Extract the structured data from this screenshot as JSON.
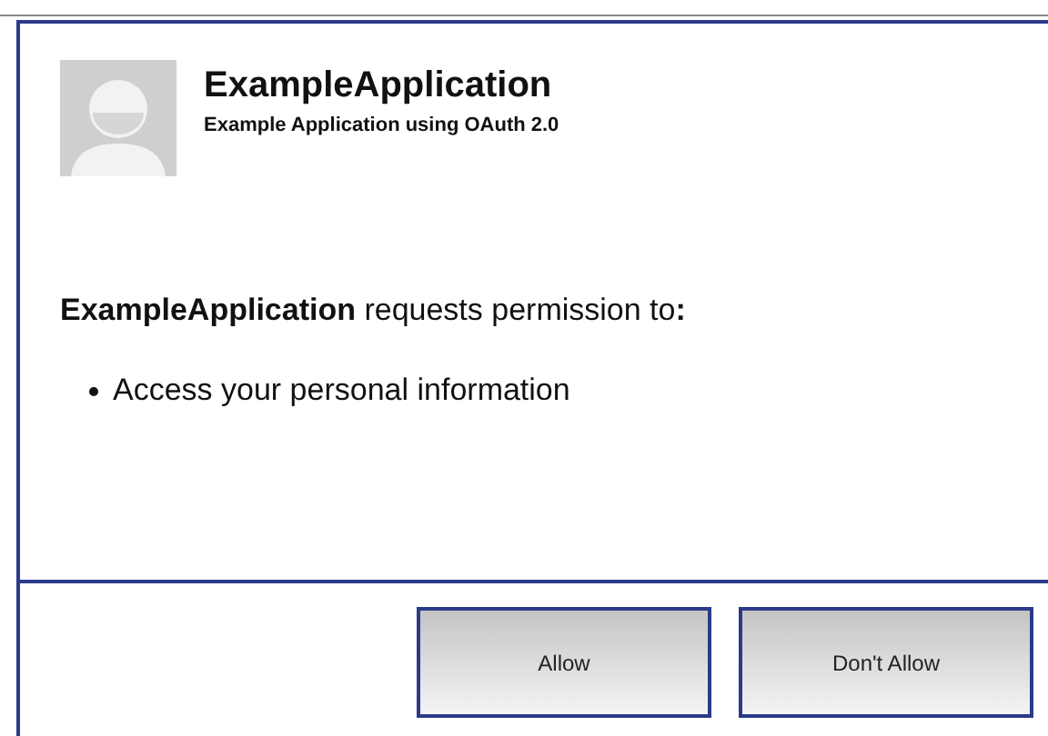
{
  "app": {
    "name": "ExampleApplication",
    "description": "Example Application using OAuth 2.0"
  },
  "request": {
    "text": "**ExampleApplication** requests permission to**:**",
    "permissions": [
      "Access your personal information"
    ]
  },
  "buttons": [
    "Allow",
    "Don't Allow"
  ]
}
